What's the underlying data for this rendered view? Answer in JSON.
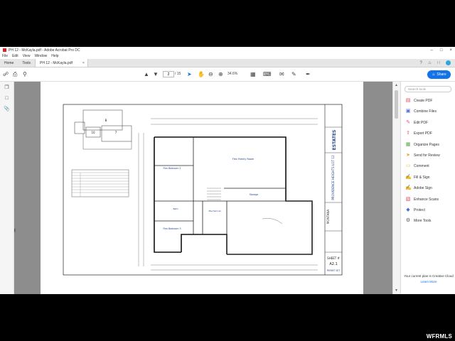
{
  "window": {
    "title": "PH 12 - McKayla.pdf - Adobe Acrobat Pro DC"
  },
  "menu": [
    "File",
    "Edit",
    "View",
    "Window",
    "Help"
  ],
  "tabs": {
    "home": "Home",
    "tools": "Tools",
    "doc": "PH 12 - McKayla.pdf"
  },
  "toolbar": {
    "page_current": "2",
    "page_total": "/ 15",
    "zoom": "34.6%",
    "share_label": "Share"
  },
  "tools_pane": {
    "search_placeholder": "Search tools",
    "items": [
      {
        "label": "Create PDF",
        "color": "#e34850",
        "icon": "create-pdf-icon"
      },
      {
        "label": "Combine Files",
        "color": "#4b6ed3",
        "icon": "combine-files-icon"
      },
      {
        "label": "Edit PDF",
        "color": "#e0489f",
        "icon": "edit-pdf-icon"
      },
      {
        "label": "Export PDF",
        "color": "#e34850",
        "icon": "export-pdf-icon"
      },
      {
        "label": "Organize Pages",
        "color": "#5ba84d",
        "icon": "organize-pages-icon"
      },
      {
        "label": "Send for Review",
        "color": "#e9a53a",
        "icon": "send-review-icon"
      },
      {
        "label": "Comment",
        "color": "#e9c23a",
        "icon": "comment-icon"
      },
      {
        "label": "Fill & Sign",
        "color": "#8d54c7",
        "icon": "fill-sign-icon"
      },
      {
        "label": "Adobe Sign",
        "color": "#8d54c7",
        "icon": "adobe-sign-icon"
      },
      {
        "label": "Enhance Scans",
        "color": "#e34850",
        "icon": "enhance-scans-icon"
      },
      {
        "label": "Protect",
        "color": "#4b6ed3",
        "icon": "protect-icon"
      },
      {
        "label": "More Tools",
        "color": "#555555",
        "icon": "more-tools-icon"
      }
    ],
    "plan_text": "Your current plan is Creative Cloud",
    "learn_more": "Learn More"
  },
  "plan_sheet": {
    "builder": "ESTATES",
    "subdivision": "PROVIDENCE HEIGHTS LOT 12",
    "model": "MONTANA",
    "sheet_label": "SHEET #",
    "sheet_number": "A2.1",
    "stamp": "PERMIT SET",
    "rooms": {
      "family": "Flex Family Room",
      "bed2": "Flex Bedroom 2",
      "bed3": "Flex Bedroom 3",
      "storage": "Storage",
      "mech": "Mechanical",
      "bath": "Bath"
    },
    "key_labels": [
      "B",
      "10",
      "7"
    ]
  },
  "watermark": "WFRMLS"
}
